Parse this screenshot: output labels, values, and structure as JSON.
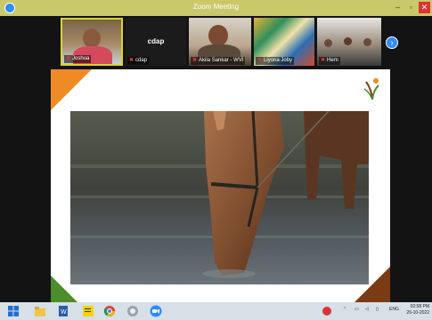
{
  "window": {
    "title": "Zoom Meeting",
    "app_icon": "zoom-icon",
    "controls": {
      "minimize": "–",
      "maximize": "▫",
      "close": "✕"
    }
  },
  "participants": [
    {
      "name": "Joshua",
      "muted": true,
      "active_speaker": true
    },
    {
      "name": "cdap",
      "muted": true,
      "video": false
    },
    {
      "name": "Akila Sankar - WVI",
      "muted": true
    },
    {
      "name": "Liyona Joby",
      "muted": true
    },
    {
      "name": "Hem",
      "muted": true
    }
  ],
  "strip_nav": {
    "icon": "chevron-right-icon",
    "glyph": "›"
  },
  "shared_slide": {
    "accent_colors": {
      "orange": "#f08a24",
      "brown": "#7a3a14",
      "green": "#4d8c2a"
    },
    "photo": "horse-drinking-water"
  },
  "taskbar": {
    "icons": [
      "windows-start-icon",
      "file-explorer-icon",
      "word-icon",
      "sticky-notes-icon",
      "chrome-icon",
      "paint-icon",
      "zoom-icon"
    ],
    "tray": {
      "lang": "ENG",
      "time": "02:58 PM",
      "date": "26-10-2022"
    }
  }
}
